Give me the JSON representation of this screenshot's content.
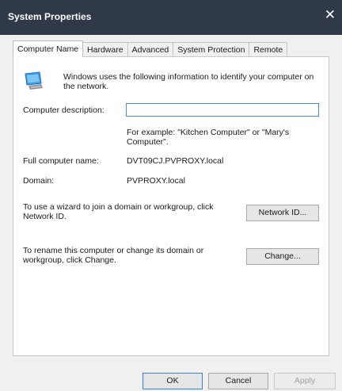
{
  "window": {
    "title": "System Properties",
    "close_glyph": "✕"
  },
  "tabs": [
    {
      "label": "Computer Name",
      "active": true
    },
    {
      "label": "Hardware",
      "active": false
    },
    {
      "label": "Advanced",
      "active": false
    },
    {
      "label": "System Protection",
      "active": false
    },
    {
      "label": "Remote",
      "active": false
    }
  ],
  "intro_text": "Windows uses the following information to identify your computer on the network.",
  "fields": {
    "description_label": "Computer description:",
    "description_value": "",
    "description_example": "For example: \"Kitchen Computer\" or \"Mary's Computer\".",
    "full_name_label": "Full computer name:",
    "full_name_value": "DVT09CJ.PVPROXY.local",
    "domain_label": "Domain:",
    "domain_value": "PVPROXY.local"
  },
  "network_id": {
    "text": "To use a wizard to join a domain or workgroup, click Network ID.",
    "button_label": "Network ID..."
  },
  "change": {
    "text": "To rename this computer or change its domain or workgroup, click Change.",
    "button_label": "Change..."
  },
  "footer": {
    "ok_label": "OK",
    "cancel_label": "Cancel",
    "apply_label": "Apply"
  },
  "icons": {
    "window_close": "close-icon",
    "computer": "computer-icon"
  },
  "colors": {
    "titlebar": "#2f3947",
    "focus_border": "#4a8ad8"
  }
}
